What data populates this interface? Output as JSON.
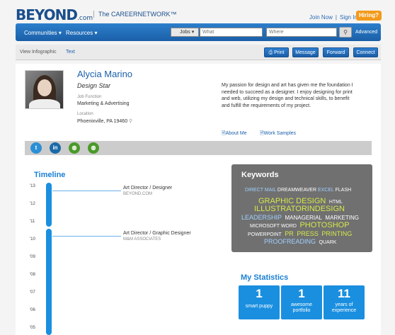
{
  "header": {
    "logo": "BEYOND",
    "logo_suffix": ".com",
    "tagline": "The CAREERNETWORK™",
    "join": "Join Now",
    "sep": "|",
    "signin": "Sign In",
    "hiring": "Hiring?"
  },
  "nav": {
    "communities": "Communities ▾",
    "resources": "Resources ▾",
    "jobs": "Jobs ▾",
    "what_placeholder": "What",
    "where_placeholder": "Where",
    "search_icon": "search-icon",
    "advanced": "Advanced"
  },
  "actions": {
    "view_infographic": "View Infographic",
    "text": "Text",
    "print": "Print",
    "message": "Message",
    "forward": "Forward",
    "connect": "Connect"
  },
  "profile": {
    "name": "Alycia Marino",
    "title": "Design Star",
    "job_function_label": "Job Function",
    "job_function": "Marketing & Advertising",
    "location_label": "Location",
    "location": "Phoenixville, PA 19460",
    "bio": "My passion for design and art has given me the foundation I needed to succeed as a designer. I enjoy designing for print and web, utilizing my design and technical skills, to benefit and fulfill the requirements of my project.",
    "about_me": "About Me",
    "work_samples": "Work Samples"
  },
  "social": [
    {
      "icon": "twitter-icon",
      "glyph": "t",
      "color": "#2b8fd6"
    },
    {
      "icon": "linkedin-icon",
      "glyph": "in",
      "color": "#1a6aa8"
    },
    {
      "icon": "web-icon",
      "glyph": "◍",
      "color": "#4a9a2a"
    },
    {
      "icon": "web-icon-2",
      "glyph": "◍",
      "color": "#4a9a2a"
    }
  ],
  "timeline": {
    "title": "Timeline",
    "years": [
      "'13",
      "'12",
      "'11",
      "'10",
      "'09",
      "'08",
      "'07",
      "'06",
      "'05"
    ],
    "jobs": [
      {
        "role": "Art Director / Designer",
        "company": "BEYOND.COM"
      },
      {
        "role": "Art Director / Graphic Designer",
        "company": "M&M ASSOCIATES"
      }
    ]
  },
  "keywords": {
    "title": "Keywords",
    "items": [
      {
        "text": "DIRECT MAIL",
        "color": "#9fd0ff"
      },
      {
        "text": "DREAMWEAVER",
        "color": "#ffffff"
      },
      {
        "text": "EXCEL",
        "color": "#9fd0ff"
      },
      {
        "text": "FLASH",
        "color": "#ffffff"
      },
      {
        "text": "GRAPHIC DESIGN",
        "color": "#d6e84a"
      },
      {
        "text": "HTML",
        "color": "#ffffff"
      },
      {
        "text": "ILLUSTRATOR",
        "color": "#d6e84a"
      },
      {
        "text": "INDESIGN",
        "color": "#d6e84a"
      },
      {
        "text": "LEADERSHIP",
        "color": "#9fd0ff"
      },
      {
        "text": "MANAGERIAL",
        "color": "#ffffff"
      },
      {
        "text": "MARKETING",
        "color": "#ffffff"
      },
      {
        "text": "MICROSOFT WORD",
        "color": "#ffffff"
      },
      {
        "text": "PHOTOSHOP",
        "color": "#d6e84a"
      },
      {
        "text": "POWERPOINT",
        "color": "#ffffff"
      },
      {
        "text": "PR",
        "color": "#d6e84a"
      },
      {
        "text": "PRESS",
        "color": "#d6e84a"
      },
      {
        "text": "PRINTING",
        "color": "#d6e84a"
      },
      {
        "text": "PROOFREADING",
        "color": "#9fd0ff"
      },
      {
        "text": "QUARK",
        "color": "#ffffff"
      }
    ]
  },
  "stats": {
    "title": "My Statistics",
    "items": [
      {
        "num": "1",
        "label1": "smart puppy",
        "label2": ""
      },
      {
        "num": "1",
        "label1": "awesome",
        "label2": "portfolio"
      },
      {
        "num": "11",
        "label1": "years of",
        "label2": "experience"
      }
    ]
  }
}
